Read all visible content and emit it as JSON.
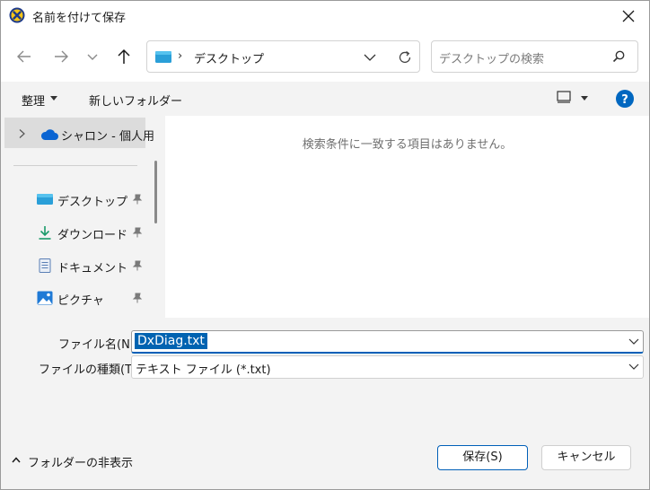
{
  "window": {
    "title": "名前を付けて保存",
    "app_icon": "dxdiag-icon",
    "close_icon": "close-icon"
  },
  "nav": {
    "back_icon": "arrow-left-icon",
    "forward_icon": "arrow-right-icon",
    "recent_icon": "chevron-down-icon",
    "up_icon": "arrow-up-icon",
    "address_separator": "›",
    "address_location": "デスクトップ",
    "refresh_icon": "refresh-icon"
  },
  "search": {
    "placeholder": "デスクトップの検索"
  },
  "commands": {
    "organize": "整理",
    "new_folder": "新しいフォルダー",
    "view_icon": "view-icon",
    "help_icon": "help-icon",
    "help_glyph": "?"
  },
  "sidebar": {
    "cloud_label": "シャロン - 個人用",
    "items": [
      {
        "label": "デスクトップ",
        "icon": "desktop-icon"
      },
      {
        "label": "ダウンロード",
        "icon": "download-icon"
      },
      {
        "label": "ドキュメント",
        "icon": "document-icon"
      },
      {
        "label": "ピクチャ",
        "icon": "picture-icon"
      }
    ]
  },
  "content": {
    "empty_message": "検索条件に一致する項目はありません。"
  },
  "fields": {
    "filename_label": "ファイル名(N):",
    "filename_value": "DxDiag.txt",
    "filetype_label": "ファイルの種類(T):",
    "filetype_value": "テキスト ファイル (*.txt)"
  },
  "footer": {
    "hide_folders": "フォルダーの非表示",
    "save": "保存(S)",
    "cancel": "キャンセル"
  },
  "colors": {
    "accent": "#005fb8",
    "selection": "#0063b1",
    "help": "#0067c0",
    "cloud": "#0a64d2"
  }
}
